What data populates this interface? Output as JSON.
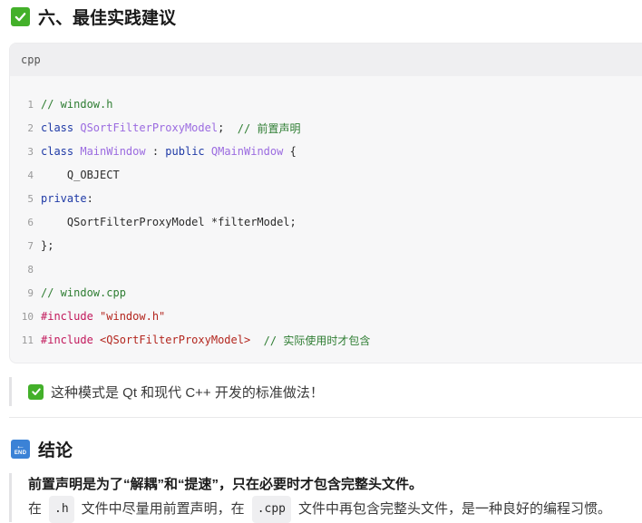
{
  "section6": {
    "title": "六、最佳实践建议",
    "icon": "check-mark-button-icon"
  },
  "code_block": {
    "language": "cpp",
    "lines": [
      {
        "num": "1",
        "tokens": [
          {
            "t": "// window.h",
            "c": "comment"
          }
        ]
      },
      {
        "num": "2",
        "tokens": [
          {
            "t": "class ",
            "c": "kw"
          },
          {
            "t": "QSortFilterProxyModel",
            "c": "type"
          },
          {
            "t": ";  ",
            "c": "plain"
          },
          {
            "t": "// 前置声明",
            "c": "comment"
          }
        ]
      },
      {
        "num": "3",
        "tokens": [
          {
            "t": "class ",
            "c": "kw"
          },
          {
            "t": "MainWindow",
            "c": "type"
          },
          {
            "t": " : ",
            "c": "plain"
          },
          {
            "t": "public ",
            "c": "kw"
          },
          {
            "t": "QMainWindow",
            "c": "type"
          },
          {
            "t": " {",
            "c": "plain"
          }
        ]
      },
      {
        "num": "4",
        "tokens": [
          {
            "t": "    Q_OBJECT",
            "c": "plain"
          }
        ]
      },
      {
        "num": "5",
        "tokens": [
          {
            "t": "private",
            "c": "kw"
          },
          {
            "t": ":",
            "c": "plain"
          }
        ]
      },
      {
        "num": "6",
        "tokens": [
          {
            "t": "    QSortFilterProxyModel *filterModel;",
            "c": "plain"
          }
        ]
      },
      {
        "num": "7",
        "tokens": [
          {
            "t": "};",
            "c": "plain"
          }
        ]
      },
      {
        "num": "8",
        "tokens": []
      },
      {
        "num": "9",
        "tokens": [
          {
            "t": "// window.cpp",
            "c": "comment"
          }
        ]
      },
      {
        "num": "10",
        "tokens": [
          {
            "t": "#include ",
            "c": "pre"
          },
          {
            "t": "\"window.h\"",
            "c": "str"
          }
        ]
      },
      {
        "num": "11",
        "tokens": [
          {
            "t": "#include ",
            "c": "pre"
          },
          {
            "t": "<QSortFilterProxyModel>",
            "c": "str"
          },
          {
            "t": "  ",
            "c": "plain"
          },
          {
            "t": "// 实际使用时才包含",
            "c": "comment"
          }
        ]
      }
    ]
  },
  "tip": {
    "text": "这种模式是 Qt 和现代 C++ 开发的标准做法！",
    "icon": "check-mark-button-icon"
  },
  "conclusion": {
    "title": "结论",
    "icon": "end-arrow-icon",
    "icon_text": "END",
    "bold_line": "前置声明是为了“解耦”和“提速”，只在必要时才包含完整头文件。",
    "line2": {
      "part1": "在",
      "code1": ".h",
      "part2": "文件中尽量用前置声明，在",
      "code2": ".cpp",
      "part3": "文件中再包含完整头文件，是一种良好的编程习惯。"
    }
  },
  "colors": {
    "comment": "#2e7d32",
    "keyword": "#1f3aa6",
    "type": "#9b6be0",
    "preprocessor": "#c2185b",
    "string": "#b3261e",
    "check_green": "#43b02a",
    "end_blue": "#3b82d6"
  }
}
